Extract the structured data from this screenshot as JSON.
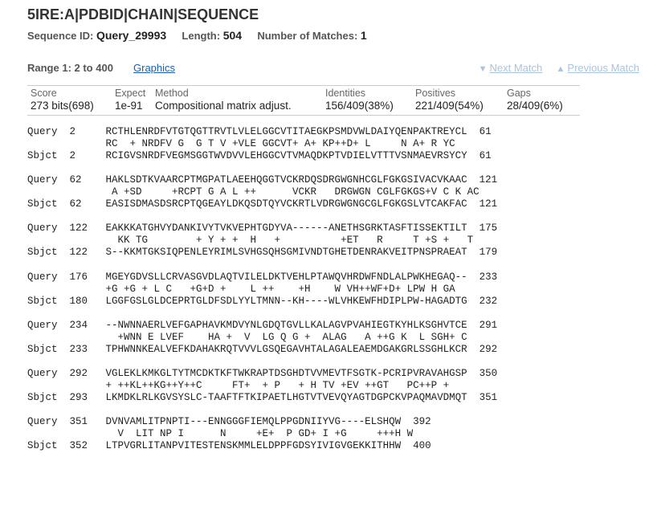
{
  "header": {
    "title": "5IRE:A|PDBID|CHAIN|SEQUENCE",
    "seq_id_label": "Sequence ID:",
    "seq_id_value": "Query_29993",
    "length_label": "Length:",
    "length_value": "504",
    "matches_label": "Number of Matches:",
    "matches_value": "1"
  },
  "range": {
    "label": "Range 1: 2 to 400",
    "graphics_link": "Graphics",
    "next_match": "Next Match",
    "previous_match": "Previous Match"
  },
  "stats": {
    "score_header": "Score",
    "score": "273 bits(698)",
    "expect_header": "Expect",
    "expect": "1e-91",
    "method_header": "Method",
    "method": "Compositional matrix adjust.",
    "identities_header": "Identities",
    "identities": "156/409(38%)",
    "positives_header": "Positives",
    "positives": "221/409(54%)",
    "gaps_header": "Gaps",
    "gaps": "28/409(6%)"
  },
  "alignment": {
    "blocks": [
      {
        "query": "Query  2     RCTHLENRDFVTGTQGTTRVTLVLELGGCVTITAEGKPSMDVWLDAIYQENPAKTREYCL  61",
        "midline": "             RC  + NRDFV G  G T V +VLE GGCVT+ A+ KP++D+ L     N A+ R YC",
        "sbjct": "Sbjct  2     RCIGVSNRDFVEGMSGGTWVDVVLEHGGCVTVMAQDKPTVDIELVTTTVSNMAEVRSYCY  61"
      },
      {
        "query": "Query  62    HAKLSDTKVAARCPTMGPATLAEEHQGGTVCKRDQSDRGWGNHCGLFGKGSIVACVKAAC  121",
        "midline": "              A +SD     +RCPT G A L ++      VCKR   DRGWGN CGLFGKGS+V C K AC",
        "sbjct": "Sbjct  62    EASISDMASDSRCPTQGEAYLDKQSDTQYVCKRTLVDRGWGNGCGLFGKGSLVTCAKFAC  121"
      },
      {
        "query": "Query  122   EAKKKATGHVYDANKIVYTVKVEPHTGDYVA------ANETHSGRKTASFTISSEKTILT  175",
        "midline": "               KK TG        + Y + +  H   +          +ET   R     T +S +   T",
        "sbjct": "Sbjct  122   S--KKMTGKSIQPENLEYRIMLSVHGSQHSGMIVNDTGHETDENRAKVEITPNSPRAEAT  179"
      },
      {
        "query": "Query  176   MGEYGDVSLLCRVASGVDLAQTVILELDKTVEHLPTAWQVHRDWFNDLALPWKHEGAQ--  233",
        "midline": "             +G +G + L C   +G+D +    L ++    +H    W VH++WF+D+ LPW H GA",
        "sbjct": "Sbjct  180   LGGFGSLGLDCEPRTGLDFSDLYYLTMNN--KH----WLVHKEWFHDIPLPW-HAGADTG  232"
      },
      {
        "query": "Query  234   --NWNNAERLVEFGAPHAVKMDVYNLGDQTGVLLKALAGVPVAHIEGTKYHLKSGHVTCE  291",
        "midline": "               +WNN E LVEF    HA +  V  LG Q G +  ALAG   A ++G K  L SGH+ C",
        "sbjct": "Sbjct  233   TPHWNNKEALVEFKDAHAKRQTVVVLGSQEGAVHTALAGALEAEMDGAKGRLSSGHLKCR  292"
      },
      {
        "query": "Query  292   VGLEKLKMKGLTYTMCDKTKFTWKRAPTDSGHDTVVMEVTFSGTK-PCRIPVRAVAHGSP  350",
        "midline": "             + ++KL++KG++Y++C     FT+  + P   + H TV +EV ++GT   PC++P +",
        "sbjct": "Sbjct  293   LKMDKLRLKGVSYSLC-TAAFTFTKIPAETLHGTVTVEVQYAGTDGPCKVPAQMAVDMQT  351"
      },
      {
        "query": "Query  351   DVNVAMLITPNPTI---ENNGGGFIEMQLPPGDNIIYVG----ELSHQW  392",
        "midline": "               V  LIT NP I      N     +E+  P GD+ I +G     +++H W",
        "sbjct": "Sbjct  352   LTPVGRLITANPVITESTENSKMMLELDPPFGDSYIVIGVGEKKITHHW  400"
      }
    ]
  }
}
